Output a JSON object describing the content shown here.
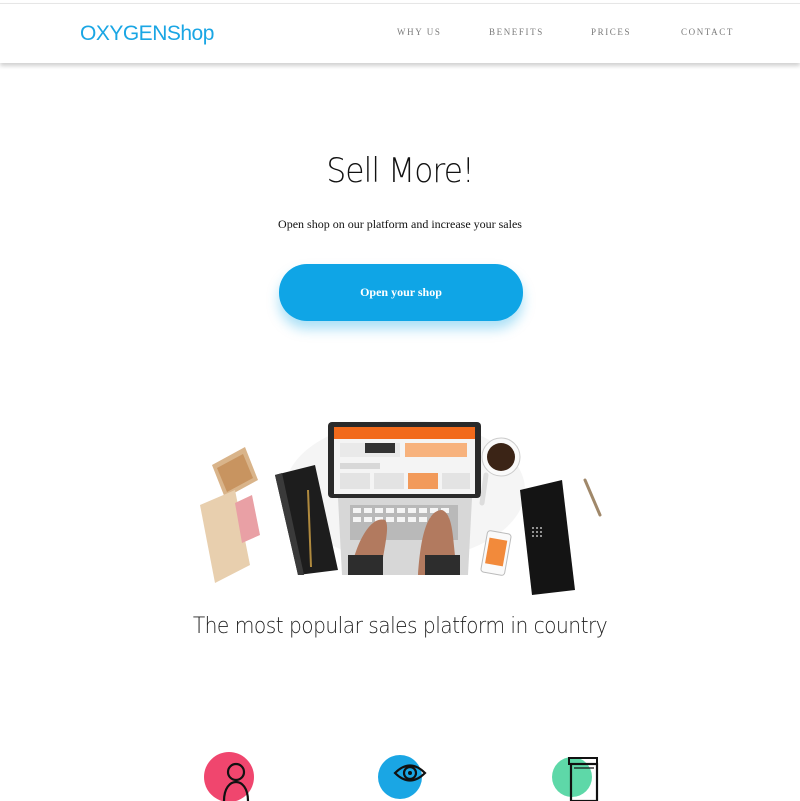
{
  "navbar": {
    "logo": "OXYGENShop",
    "links": [
      "WHY US",
      "BENEFITS",
      "PRICES",
      "CONTACT"
    ]
  },
  "hero": {
    "title": "Sell More!",
    "subtitle": "Open shop on our platform and increase your sales",
    "cta_label": "Open your shop"
  },
  "section": {
    "tagline": "The most popular sales platform in country"
  },
  "features": [
    {
      "icon": "user-icon",
      "color": "#f0466e"
    },
    {
      "icon": "eye-icon",
      "color": "#1aa6e4"
    },
    {
      "icon": "documents-icon",
      "color": "#5ed8a8"
    }
  ],
  "colors": {
    "accent": "#1aa6e4",
    "button": "#0fa5e6"
  }
}
